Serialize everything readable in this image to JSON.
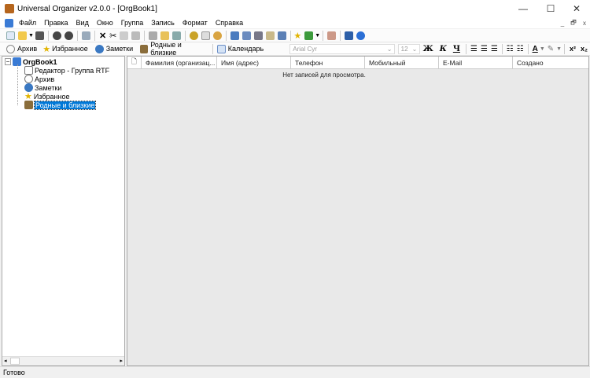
{
  "window": {
    "title": "Universal Organizer v2.0.0 - [OrgBook1]",
    "minimize": "—",
    "maximize": "☐",
    "close": "✕",
    "mdi_min": "_",
    "mdi_restore": "🗗",
    "mdi_close": "x"
  },
  "menu": [
    "Файл",
    "Правка",
    "Вид",
    "Окно",
    "Группа",
    "Запись",
    "Формат",
    "Справка"
  ],
  "toolbar2": {
    "archive": "Архив",
    "favorites": "Избранное",
    "notes": "Заметки",
    "relatives": "Родные и близкие",
    "calendar": "Календарь",
    "font": "Arial Cyr",
    "size": "12",
    "bold": "Ж",
    "italic": "К",
    "underline": "Ч",
    "superscript": "x²",
    "subscript": "x₂"
  },
  "tree": {
    "root": "OrgBook1",
    "items": [
      "Редактор - Группа RTF",
      "Архив",
      "Заметки",
      "Избранное",
      "Родные и близкие"
    ],
    "selected": "Родные и близкие"
  },
  "grid": {
    "columns": [
      "Фамилия (организац...",
      "Имя (адрес)",
      "Телефон",
      "Мобильный",
      "E-Mail",
      "Создано"
    ],
    "empty_message": "Нет записей для просмотра."
  },
  "status": "Готово"
}
